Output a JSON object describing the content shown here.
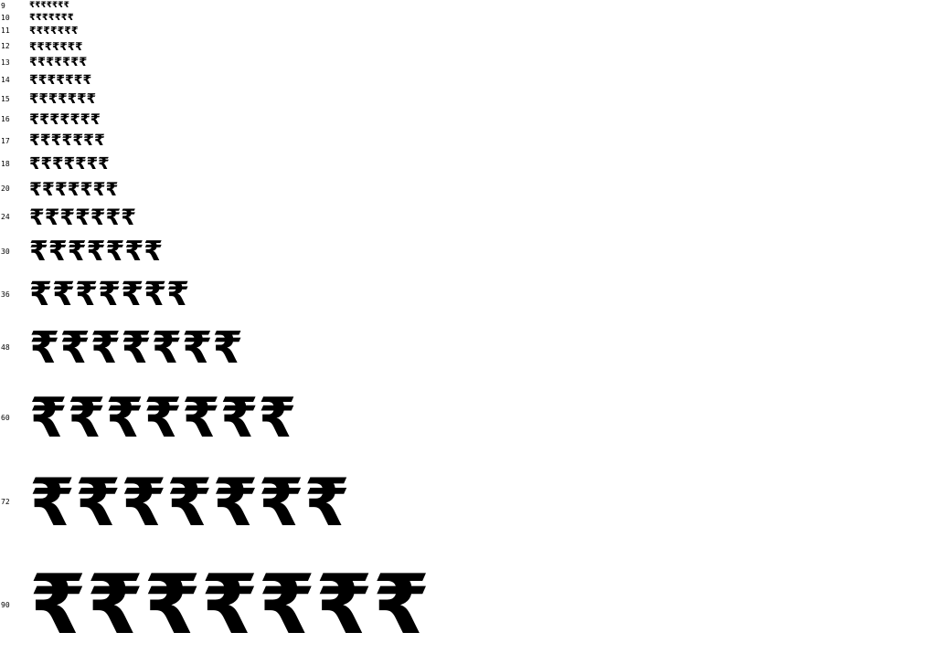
{
  "specimen": {
    "glyph_sample": "₹₹₹₹₹₹₹",
    "rows": [
      {
        "size_label": "9"
      },
      {
        "size_label": "10"
      },
      {
        "size_label": "11"
      },
      {
        "size_label": "12"
      },
      {
        "size_label": "13"
      },
      {
        "size_label": "14"
      },
      {
        "size_label": "15"
      },
      {
        "size_label": "16"
      },
      {
        "size_label": "17"
      },
      {
        "size_label": "18"
      },
      {
        "size_label": "20"
      },
      {
        "size_label": "24"
      },
      {
        "size_label": "30"
      },
      {
        "size_label": "36"
      },
      {
        "size_label": "48"
      },
      {
        "size_label": "60"
      },
      {
        "size_label": "72"
      },
      {
        "size_label": "90"
      }
    ]
  }
}
